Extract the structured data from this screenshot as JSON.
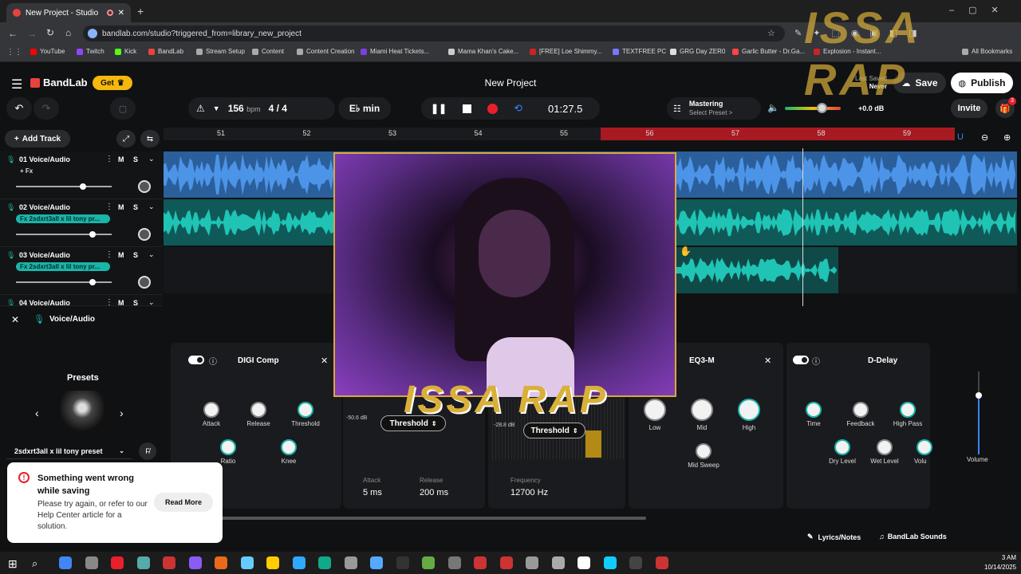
{
  "browser": {
    "tab_title": "New Project - Studio",
    "url": "bandlab.com/studio?triggered_from=library_new_project",
    "bookmarks": [
      "YouTube",
      "Twitch",
      "Kick",
      "BandLab",
      "Stream Setup",
      "Content",
      "Content Creation",
      "Miami Heat Tickets...",
      "Mama Khan's Cake...",
      "[FREE] Loe Shimmy...",
      "TEXTFREE PC",
      "GRG Day ZER0",
      "Garlic Butter - Dr.Ga...",
      "Explosion - Instant...",
      "All Bookmarks"
    ],
    "bookmark_colors": [
      "#ff0000",
      "#9146ff",
      "#53fc18",
      "#e8423c",
      "#aaaaaa",
      "#aaaaaa",
      "#aaaaaa",
      "#7b3fe4",
      "#cccccc",
      "#cc2222",
      "#7777ff",
      "#dddddd",
      "#ff4444",
      "#cc2222",
      "#aaaaaa"
    ]
  },
  "header": {
    "brand": "BandLab",
    "get_label": "Get",
    "project_title": "New Project",
    "last_saved_label": "Last Saved",
    "last_saved_value": "Never",
    "save_label": "Save",
    "publish_label": "Publish"
  },
  "transport": {
    "bpm": "156",
    "bpm_unit": "bpm",
    "time_sig": "4 / 4",
    "key": "E♭ min",
    "time": "01:27.5",
    "mastering_title": "Mastering",
    "mastering_sub": "Select Preset >",
    "gain": "+0.0 dB",
    "invite_label": "Invite",
    "notif_count": "3"
  },
  "timeline": {
    "add_track_label": "Add Track",
    "bars": [
      "51",
      "52",
      "53",
      "54",
      "55",
      "56",
      "57",
      "58",
      "59"
    ]
  },
  "tracks": [
    {
      "name": "01  Voice/Audio",
      "fx": "+ Fx",
      "mute": "M",
      "solo": "S",
      "volume": 0.7
    },
    {
      "name": "02  Voice/Audio",
      "fx": "Fx 2sdxrt3all x lil tony pr...",
      "mute": "M",
      "solo": "S",
      "volume": 0.8
    },
    {
      "name": "03  Voice/Audio",
      "fx": "Fx 2sdxrt3all x lil tony pr...",
      "mute": "M",
      "solo": "S",
      "volume": 0.8
    },
    {
      "name": "04  Voice/Audio",
      "fx": "",
      "mute": "M",
      "solo": "S",
      "volume": 0.8
    }
  ],
  "panel": {
    "track_label": "Voice/Audio",
    "presets_label": "Presets",
    "preset_name": "2sdxrt3all x lil tony preset",
    "digi_comp": {
      "title": "DIGI Comp",
      "attack": "Attack",
      "release": "Release",
      "threshold": "Threshold",
      "ratio": "Ratio",
      "knee": "Knee"
    },
    "middle": {
      "threshold_val": "-50.6 dB",
      "threshold_label": "Threshold",
      "attack_label": "Attack",
      "attack_val": "5 ms",
      "release_label": "Release",
      "release_val": "200 ms"
    },
    "deesser": {
      "threshold_val": "-28.8 dB",
      "threshold_label": "Threshold",
      "freq_label": "Frequency",
      "freq_val": "12700 Hz"
    },
    "eq": {
      "title": "EQ3-M",
      "low": "Low",
      "mid": "Mid",
      "high": "High",
      "sweep": "Mid Sweep"
    },
    "delay": {
      "title": "D-Delay",
      "time": "Time",
      "feedback": "Feedback",
      "highpass": "High Pass",
      "dry": "Dry Level",
      "wet": "Wet Level",
      "volume": "Volu"
    },
    "volume_label": "Volume"
  },
  "error": {
    "title": "Something went wrong while saving",
    "body": "Please try again, or refer to our Help Center article for a solution.",
    "action": "Read More"
  },
  "bottom": {
    "lyrics": "Lyrics/Notes",
    "sounds": "BandLab Sounds"
  },
  "overlay": {
    "logo_text": "ISSA RAP"
  },
  "clock": {
    "time": "3 AM",
    "date": "10/14/2025"
  }
}
